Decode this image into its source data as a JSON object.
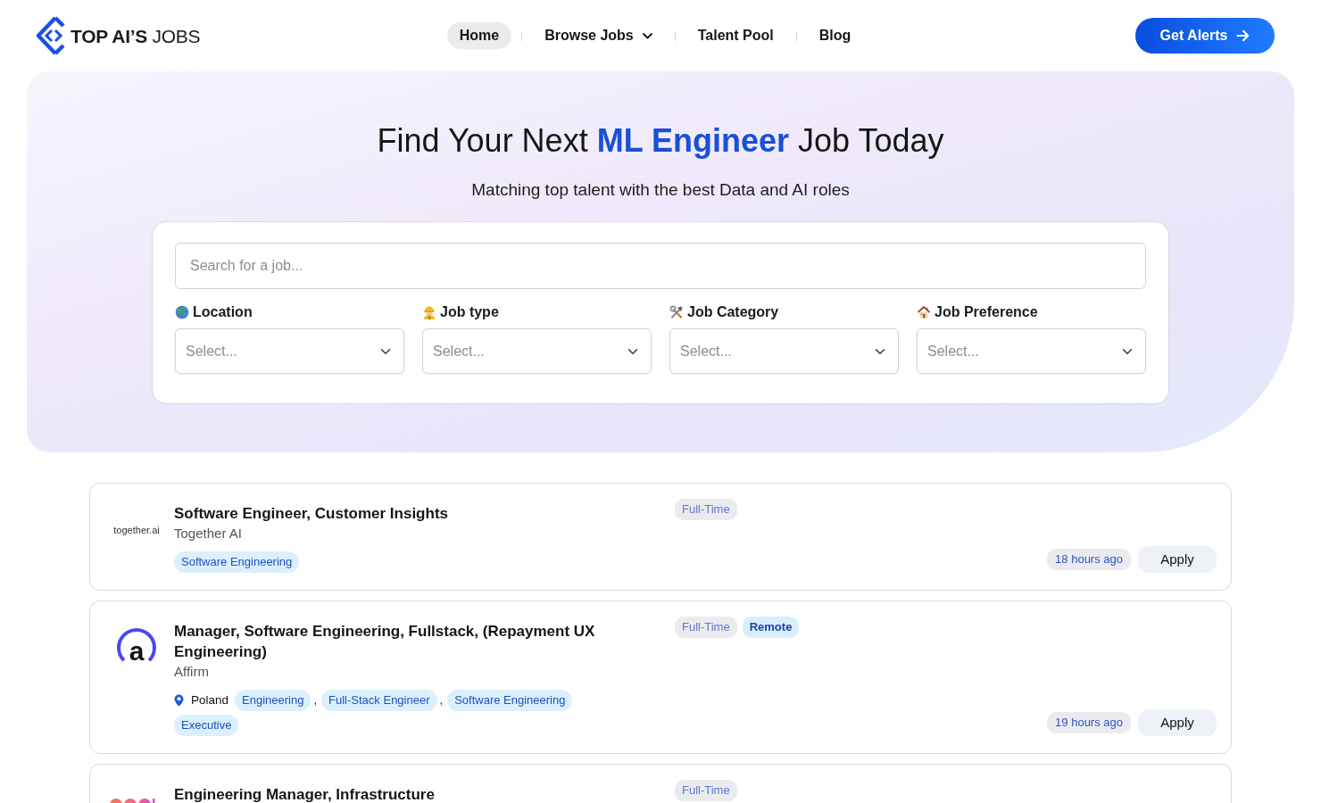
{
  "header": {
    "logo_text": "**TOP AI’S** JOBS",
    "nav": [
      {
        "label": "Home",
        "kind": "link",
        "selected": true
      },
      {
        "label": "Browse Jobs",
        "kind": "dropdown",
        "selected": false
      },
      {
        "label": "Talent Pool",
        "kind": "link",
        "selected": false
      },
      {
        "label": "Blog",
        "kind": "link",
        "selected": false
      }
    ],
    "cta": {
      "label": "Get Alerts"
    }
  },
  "hero": {
    "title": "Find Your Next **ML Engineer** Job Today",
    "subtitle": "Matching top talent with the best Data and AI roles",
    "search": {
      "placeholder": "Search for a job..."
    },
    "filters": [
      {
        "kind": "location",
        "label": "Location",
        "placeholder": "Select..."
      },
      {
        "kind": "job_type",
        "label": "Job type",
        "placeholder": "Select..."
      },
      {
        "kind": "category",
        "label": "Job Category",
        "placeholder": "Select..."
      },
      {
        "kind": "preference",
        "label": "Job Preference",
        "placeholder": "Select..."
      }
    ]
  },
  "jobs": [
    {
      "logo": {
        "kind": "wordmark",
        "text": "together.ai"
      },
      "title": "Software Engineer, Customer Insights",
      "company": "Together AI",
      "tags": [
        {
          "kind": "category",
          "label": "Software Engineering"
        }
      ],
      "badges": [
        {
          "kind": "employment",
          "label": "Full-Time"
        }
      ],
      "posted": "18 hours ago",
      "action": "Apply"
    },
    {
      "logo": {
        "kind": "letter",
        "text": "a"
      },
      "title": "Manager, Software Engineering, Fullstack, (Repayment UX Engineering)",
      "company": "Affirm",
      "location": "Poland",
      "tags": [
        {
          "kind": "category",
          "label": "Engineering"
        },
        {
          "kind": "separator",
          "label": ","
        },
        {
          "kind": "category",
          "label": "Full-Stack Engineer"
        },
        {
          "kind": "separator",
          "label": ","
        },
        {
          "kind": "category",
          "label": "Software Engineering"
        },
        {
          "kind": "level",
          "label": "Executive"
        }
      ],
      "badges": [
        {
          "kind": "employment",
          "label": "Full-Time"
        },
        {
          "kind": "workplace",
          "label": "Remote"
        }
      ],
      "posted": "19 hours ago",
      "action": "Apply"
    },
    {
      "logo": {
        "kind": "graphic"
      },
      "title": "Engineering Manager, Infrastructure",
      "badges": [
        {
          "kind": "employment",
          "label": "Full-Time"
        }
      ]
    }
  ]
}
